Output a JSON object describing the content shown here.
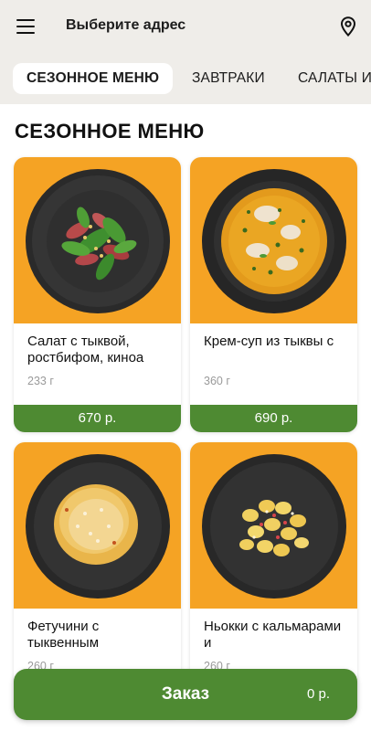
{
  "header": {
    "address_label": "Выберите адрес",
    "menu_icon": "hamburger-menu-icon",
    "location_icon": "map-pin-icon"
  },
  "tabs": [
    {
      "label": "СЕЗОННОЕ МЕНЮ",
      "active": true
    },
    {
      "label": "ЗАВТРАКИ",
      "active": false
    },
    {
      "label": "САЛАТЫ И",
      "active": false
    }
  ],
  "section_title": "СЕЗОННОЕ МЕНЮ",
  "products": [
    {
      "name": "Салат с тыквой, ростбифом, киноа",
      "weight": "233 г",
      "price": "670 р."
    },
    {
      "name": "Крем-суп из тыквы с",
      "weight": "360 г",
      "price": "690 р."
    },
    {
      "name": "Фетучини с тыквенным",
      "weight": "260 г",
      "price": ""
    },
    {
      "name": "Ньокки с кальмарами  и",
      "weight": "260 г",
      "price": ""
    }
  ],
  "order": {
    "label": "Заказ",
    "total": "0 р."
  },
  "colors": {
    "accent_green": "#4e8a32",
    "photo_orange": "#f5a324",
    "header_bg": "#efede9"
  }
}
